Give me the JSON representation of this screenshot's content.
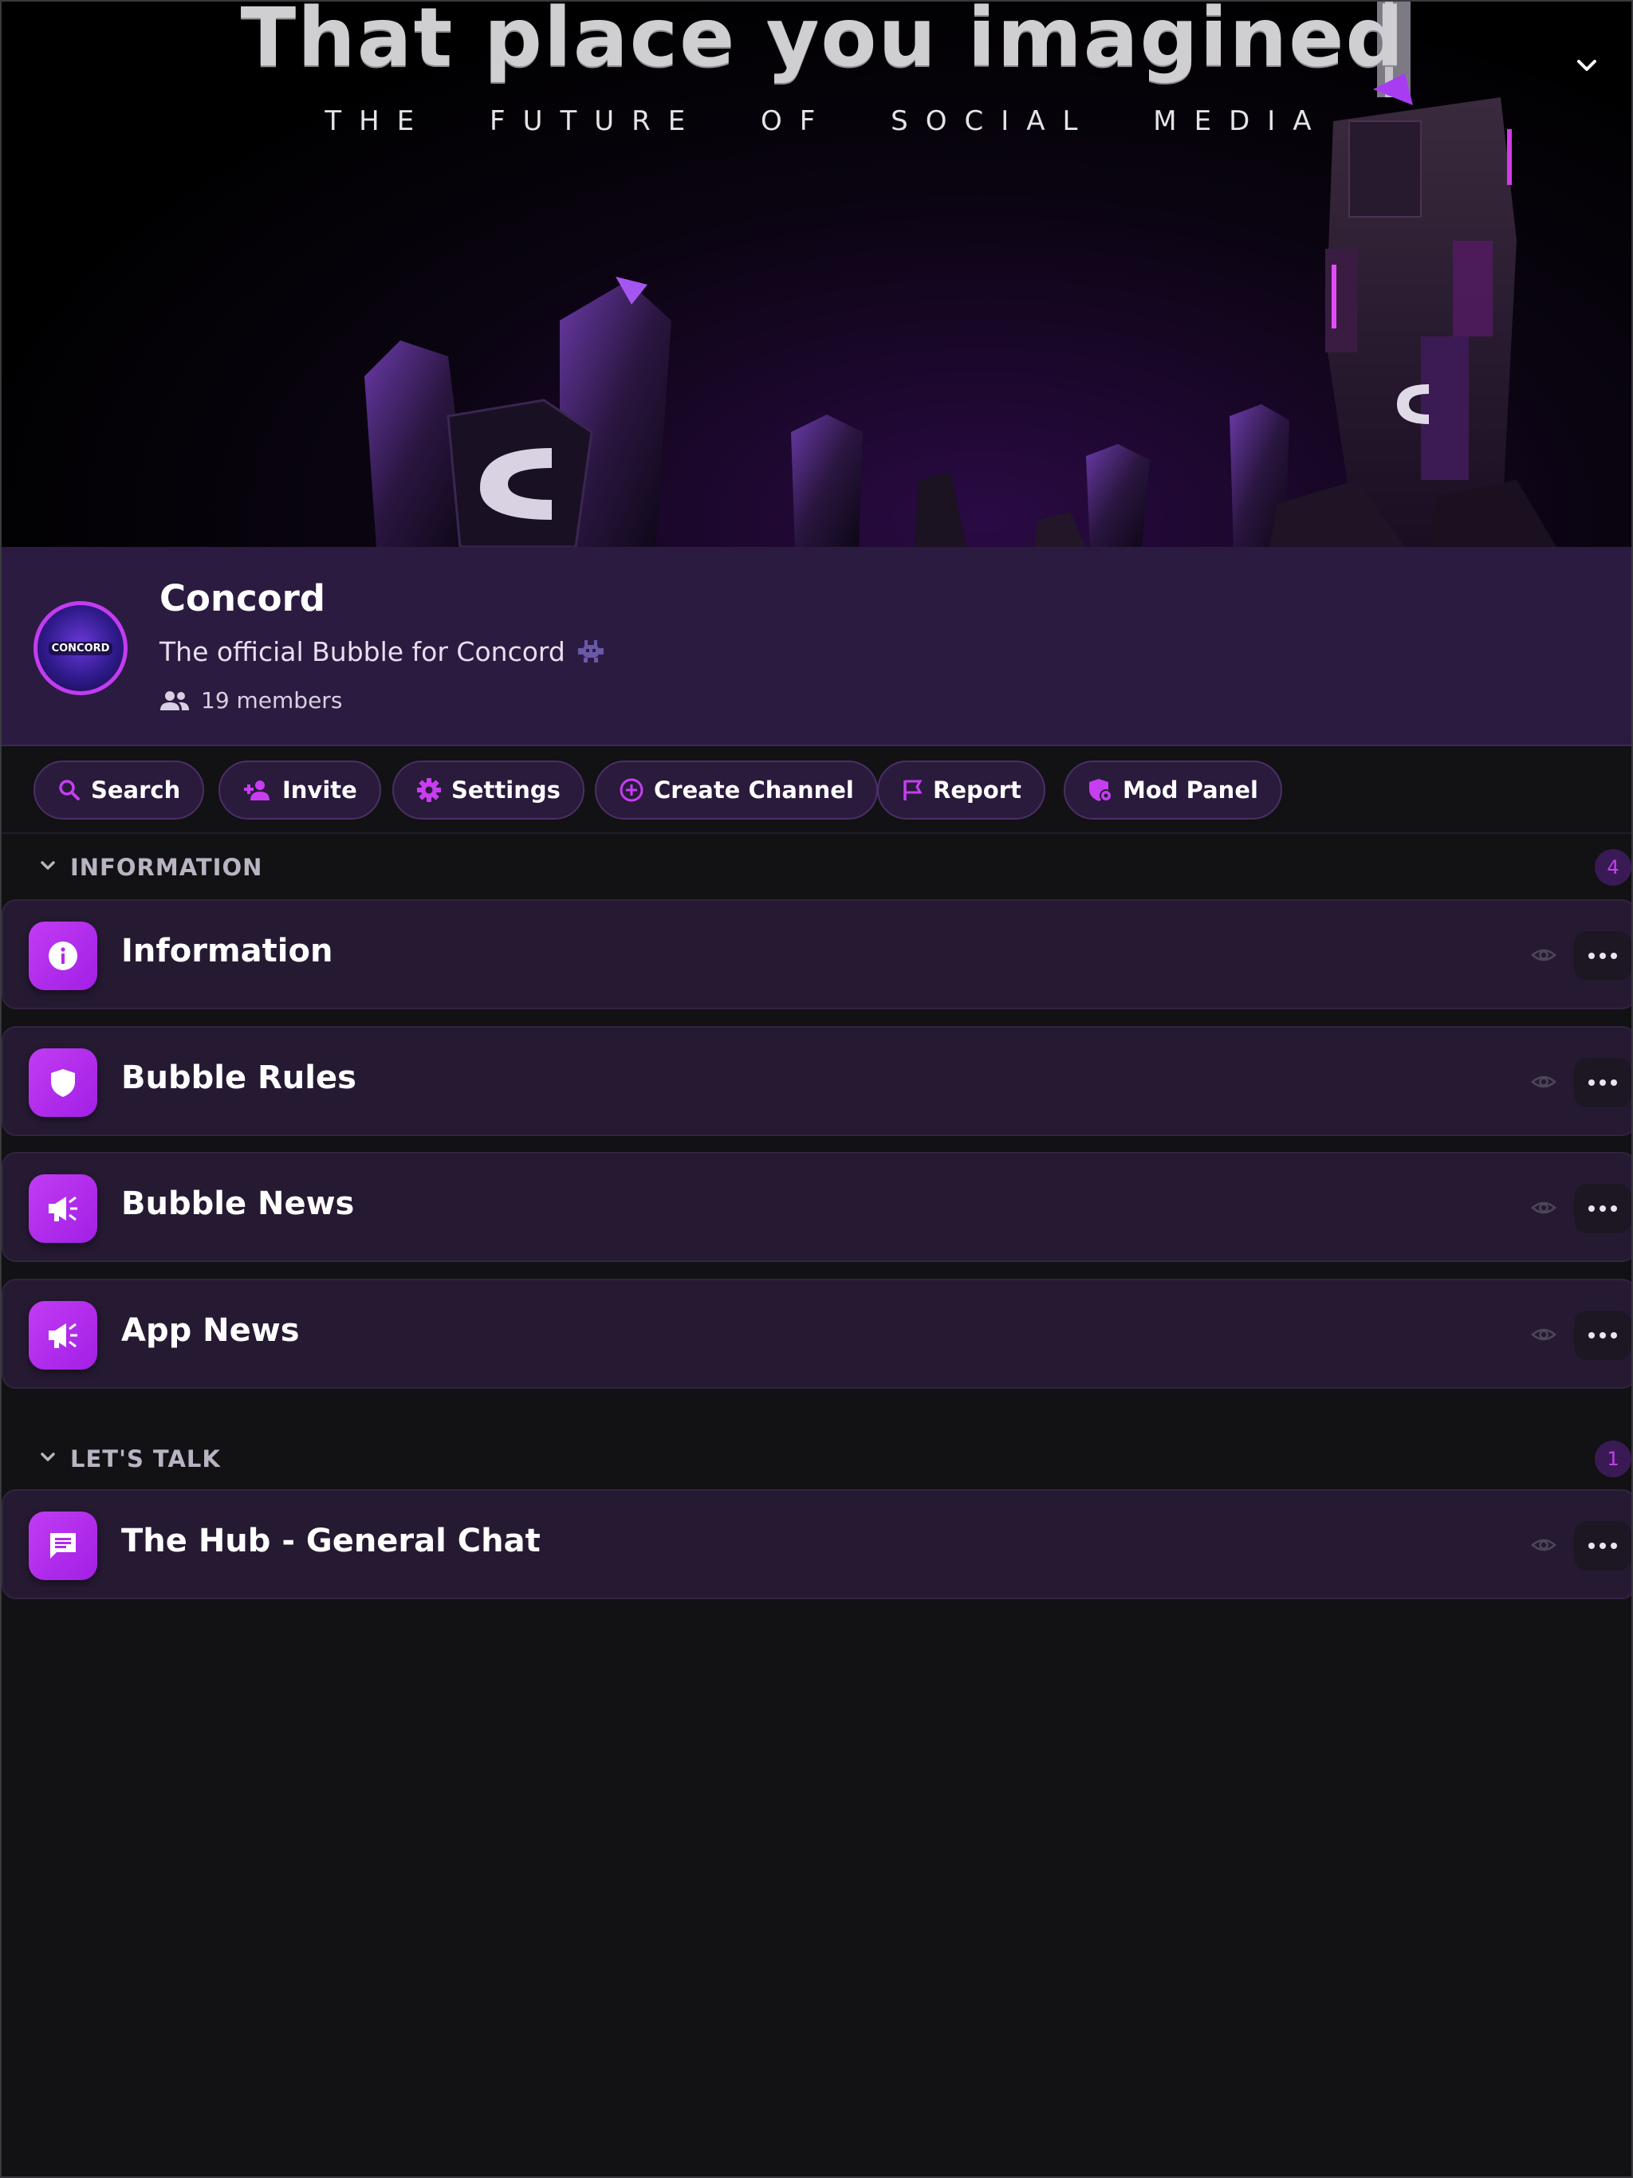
{
  "banner": {
    "title": "That place you imagined",
    "subtitle": "THE FUTURE OF SOCIAL MEDIA",
    "collapse_icon": "chevron-down-icon"
  },
  "bubble": {
    "name": "Concord",
    "description": "The official Bubble for Concord",
    "description_icon": "alien-icon",
    "members": "19 members",
    "avatar_text": "CONCORD"
  },
  "actions": [
    {
      "label": "Search",
      "icon": "search-icon"
    },
    {
      "label": "Invite",
      "icon": "add-user-icon"
    },
    {
      "label": "Settings",
      "icon": "gear-icon"
    },
    {
      "label": "Create Channel",
      "icon": "plus-circle-icon"
    },
    {
      "label": "Report",
      "icon": "flag-icon"
    },
    {
      "label": "Mod Panel",
      "icon": "shield-icon"
    }
  ],
  "sections": [
    {
      "title": "INFORMATION",
      "count": "4",
      "channels": [
        {
          "name": "Information",
          "icon": "info-icon"
        },
        {
          "name": "Bubble Rules",
          "icon": "shield-icon"
        },
        {
          "name": "Bubble News",
          "icon": "megaphone-icon"
        },
        {
          "name": "App News",
          "icon": "megaphone-icon"
        }
      ]
    },
    {
      "title": "LET'S TALK",
      "count": "1",
      "channels": [
        {
          "name": "The Hub - General Chat",
          "icon": "chat-icon"
        }
      ]
    }
  ],
  "colors": {
    "accent": "#b52cf0",
    "header_bg": "#2b1b40",
    "channel_bg": "#261a33",
    "page_bg": "#121113"
  }
}
